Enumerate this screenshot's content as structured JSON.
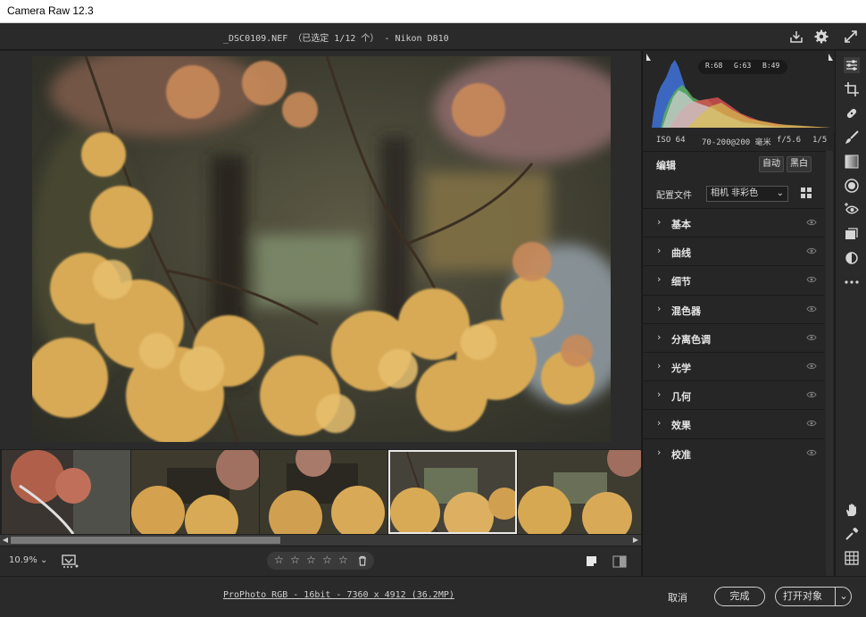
{
  "window": {
    "title": "Camera Raw 12.3"
  },
  "header": {
    "filename": "_DSC0109.NEF （已选定 1/12 个） - Nikon D810"
  },
  "histogram": {
    "r": "R:68",
    "g": "G:63",
    "b": "B:49"
  },
  "exif": {
    "iso": "ISO 64",
    "lens": "70-200@200 毫米",
    "aperture": "f/5.6",
    "shutter": "1/5"
  },
  "edit": {
    "title": "编辑",
    "auto": "自动",
    "bw": "黑白"
  },
  "profile": {
    "label": "配置文件",
    "value": "相机 非彩色"
  },
  "sections": [
    {
      "label": "基本"
    },
    {
      "label": "曲线"
    },
    {
      "label": "细节"
    },
    {
      "label": "混色器"
    },
    {
      "label": "分离色调"
    },
    {
      "label": "光学"
    },
    {
      "label": "几何"
    },
    {
      "label": "效果"
    },
    {
      "label": "校准"
    }
  ],
  "bottombar": {
    "zoom": "10.9%"
  },
  "footer": {
    "workflow": "ProPhoto RGB - 16bit - 7360 x 4912 (36.2MP)",
    "cancel": "取消",
    "done": "完成",
    "open": "打开对象"
  },
  "colors": {
    "accent_selected": "#e8e8e8",
    "panel_bg": "#262626",
    "toolbar_bg": "#2a2a2a"
  },
  "icons": [
    "save-icon",
    "gear-icon",
    "fullscreen-icon",
    "sliders-icon",
    "crop-icon",
    "heal-icon",
    "brush-icon",
    "gradient-icon",
    "radial-icon",
    "redeye-icon",
    "snapshots-icon",
    "presets-icon",
    "more-icon",
    "hand-icon",
    "eyedropper-icon",
    "grid-icon",
    "star-icon",
    "trash-icon",
    "eye-icon",
    "chevron-right-icon"
  ]
}
